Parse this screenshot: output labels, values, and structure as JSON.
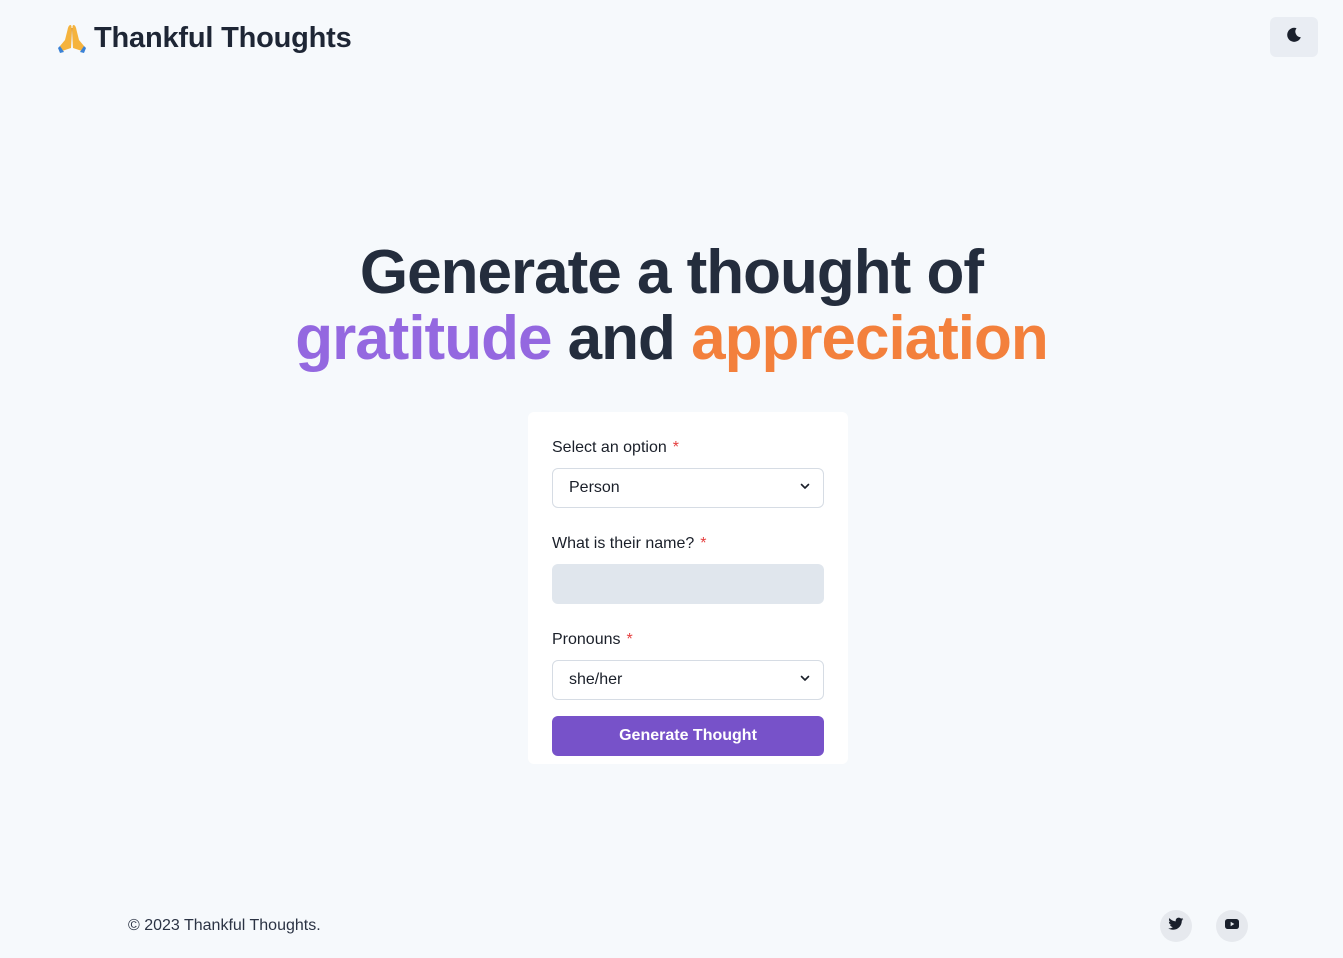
{
  "header": {
    "brand_emoji": "🙏",
    "title": "Thankful Thoughts",
    "theme_toggle_icon": "moon-icon"
  },
  "hero": {
    "line1": "Generate a thought of",
    "word_gratitude": "gratitude",
    "word_and": "and",
    "word_appreciation": "appreciation",
    "colors": {
      "text": "#242d3d",
      "purple": "#9468e0",
      "orange": "#f3803c"
    }
  },
  "form": {
    "option": {
      "label": "Select an option",
      "required_mark": "*",
      "value": "Person"
    },
    "name": {
      "label": "What is their name?",
      "required_mark": "*",
      "value": "",
      "placeholder": ""
    },
    "pronouns": {
      "label": "Pronouns",
      "required_mark": "*",
      "value": "she/her"
    },
    "submit_label": "Generate Thought",
    "button_color": "#7752c9"
  },
  "footer": {
    "copyright": "© 2023 Thankful Thoughts.",
    "social": [
      "twitter-icon",
      "youtube-icon"
    ]
  }
}
